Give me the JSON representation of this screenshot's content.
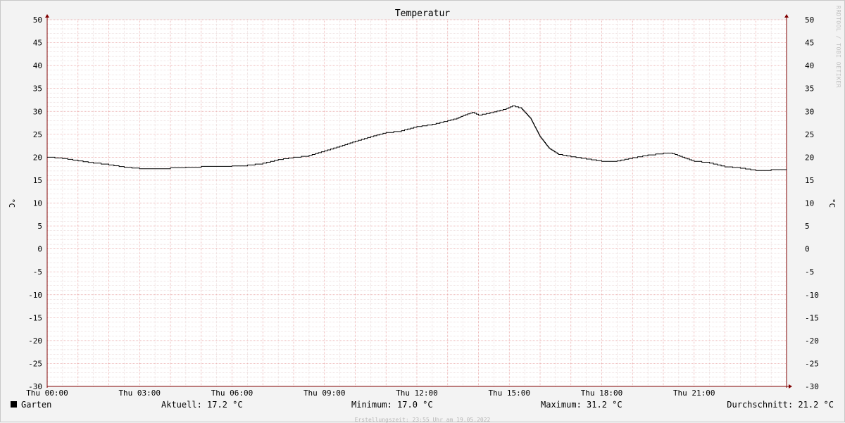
{
  "watermark": "RRDTOOL / TOBI OETIKER",
  "chart_data": {
    "type": "line",
    "title": "Temperatur",
    "ylabel": "°C",
    "ylabel_right": "°C",
    "ylim": [
      -30,
      50
    ],
    "yticks": [
      50,
      45,
      40,
      35,
      30,
      25,
      20,
      15,
      10,
      5,
      0,
      -5,
      -10,
      -15,
      -20,
      -25,
      -30
    ],
    "xlim": [
      0,
      24
    ],
    "xticks": [
      {
        "x": 0,
        "label": "Thu 00:00"
      },
      {
        "x": 3,
        "label": "Thu 03:00"
      },
      {
        "x": 6,
        "label": "Thu 06:00"
      },
      {
        "x": 9,
        "label": "Thu 09:00"
      },
      {
        "x": 12,
        "label": "Thu 12:00"
      },
      {
        "x": 15,
        "label": "Thu 15:00"
      },
      {
        "x": 18,
        "label": "Thu 18:00"
      },
      {
        "x": 21,
        "label": "Thu 21:00"
      }
    ],
    "grid": true,
    "series": [
      {
        "name": "Garten",
        "color": "#000000",
        "x": [
          0,
          0.5,
          1,
          1.5,
          2,
          2.5,
          3,
          3.5,
          4,
          4.5,
          5,
          5.5,
          6,
          6.5,
          7,
          7.5,
          8,
          8.5,
          9,
          9.5,
          10,
          10.5,
          11,
          11.5,
          12,
          12.5,
          13,
          13.3,
          13.5,
          13.8,
          14,
          14.5,
          14.9,
          15.1,
          15.4,
          15.7,
          16,
          16.3,
          16.6,
          17,
          17.5,
          18,
          18.5,
          19,
          19.5,
          20,
          20.3,
          20.7,
          21,
          21.5,
          22,
          22.5,
          23,
          23.5,
          24
        ],
        "y": [
          20.0,
          19.7,
          19.2,
          18.7,
          18.3,
          17.8,
          17.5,
          17.5,
          17.7,
          17.8,
          18.0,
          18.0,
          18.1,
          18.3,
          18.7,
          19.5,
          20.0,
          20.4,
          21.4,
          22.4,
          23.5,
          24.5,
          25.4,
          25.8,
          26.7,
          27.2,
          28.0,
          28.5,
          29.1,
          29.8,
          29.2,
          29.9,
          30.6,
          31.2,
          30.6,
          28.4,
          24.5,
          21.9,
          20.6,
          20.1,
          19.6,
          19.1,
          19.2,
          19.9,
          20.5,
          20.9,
          20.8,
          19.8,
          19.1,
          18.7,
          17.9,
          17.6,
          17.1,
          17.3,
          17.2
        ]
      }
    ]
  },
  "legend": {
    "name": "Garten",
    "aktuell": "Aktuell: 17.2 °C",
    "minimum": "Minimum: 17.0 °C",
    "maximum": "Maximum: 31.2 °C",
    "durchschnitt": "Durchschnitt: 21.2 °C"
  },
  "credit": "Erstellungszeit: 23:55 Uhr am 19.05.2022",
  "colors": {
    "major_grid": "#e8a0a0",
    "minor_grid": "#e0c8c8",
    "axis": "#800000",
    "background": "#f3f3f3",
    "plot_background": "#ffffff"
  }
}
